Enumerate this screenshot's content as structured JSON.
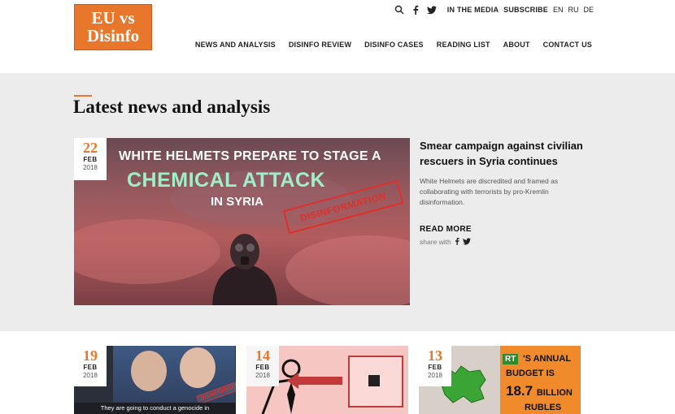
{
  "logo": {
    "line1": "EU vs",
    "line2": "Disinfo"
  },
  "topbar": {
    "links": [
      "IN THE MEDIA",
      "SUBSCRIBE"
    ],
    "languages": [
      "EN",
      "RU",
      "DE"
    ]
  },
  "nav": {
    "items": [
      "NEWS AND ANALYSIS",
      "DISINFO REVIEW",
      "DISINFO CASES",
      "READING LIST",
      "ABOUT",
      "CONTACT US"
    ]
  },
  "section": {
    "title": "Latest news and analysis"
  },
  "featured": {
    "date": {
      "day": "22",
      "month": "FEB",
      "year": "2018"
    },
    "image_text": {
      "line1": "WHITE HELMETS PREPARE TO STAGE A",
      "line2": "CHEMICAL ATTACK",
      "line3": "IN SYRIA",
      "stamp": "DISINFORMATION"
    },
    "title": "Smear campaign against civilian rescuers in Syria continues",
    "description": "White Helmets are discredited and framed as collaborating with terrorists by pro-Kremlin disinformation.",
    "read_more": "READ MORE",
    "share_label": "share with"
  },
  "cards": [
    {
      "date": {
        "day": "19",
        "month": "FEB",
        "year": "2018"
      },
      "caption": "They are going to conduct a genocide in",
      "stamp": "DISINFORMATION"
    },
    {
      "date": {
        "day": "14",
        "month": "FEB",
        "year": "2018"
      }
    },
    {
      "date": {
        "day": "13",
        "month": "FEB",
        "year": "2018"
      },
      "logo": "RT",
      "lines": [
        "'S ANNUAL",
        "BUDGET IS",
        "18.7",
        "BILLION",
        "RUBLES"
      ]
    }
  ],
  "colors": {
    "accent": "#e8762b",
    "stamp_red": "#e0302a",
    "band_gray": "#ececec"
  }
}
